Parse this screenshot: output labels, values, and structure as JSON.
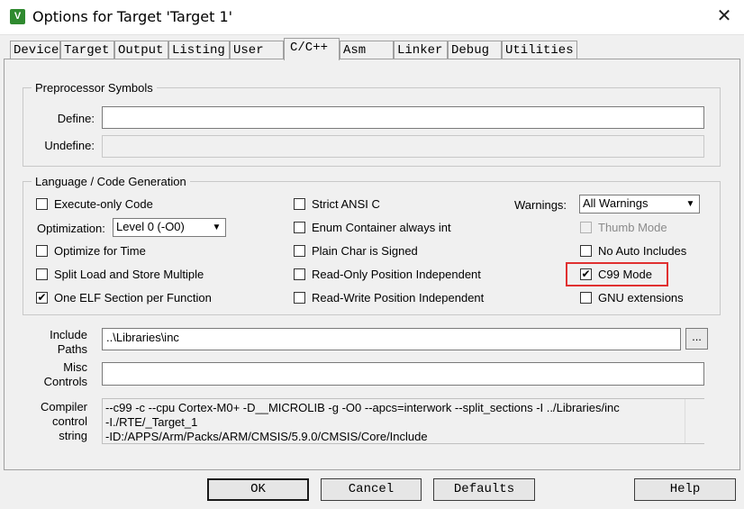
{
  "window": {
    "title": "Options for Target 'Target 1'",
    "close_glyph": "✕",
    "icon_glyph": "V"
  },
  "tabs": [
    "Device",
    "Target",
    "Output",
    "Listing",
    "User",
    "C/C++",
    "Asm",
    "Linker",
    "Debug",
    "Utilities"
  ],
  "active_tab": "C/C++",
  "preprocessor": {
    "title": "Preprocessor Symbols",
    "define_label": "Define:",
    "define_value": "",
    "undefine_label": "Undefine:",
    "undefine_value": ""
  },
  "language": {
    "title": "Language / Code Generation",
    "execute_only": {
      "label": "Execute-only Code",
      "checked": false
    },
    "optimization": {
      "label": "Optimization:",
      "value": "Level 0 (-O0)"
    },
    "optimize_time": {
      "label": "Optimize for Time",
      "checked": false
    },
    "split_load": {
      "label": "Split Load and Store Multiple",
      "checked": false
    },
    "one_elf": {
      "label": "One ELF Section per Function",
      "checked": true
    },
    "strict_ansi": {
      "label": "Strict ANSI C",
      "checked": false
    },
    "enum_container": {
      "label": "Enum Container always int",
      "checked": false
    },
    "plain_char": {
      "label": "Plain Char is Signed",
      "checked": false
    },
    "ro_pi": {
      "label": "Read-Only Position Independent",
      "checked": false
    },
    "rw_pi": {
      "label": "Read-Write Position Independent",
      "checked": false
    },
    "warnings": {
      "label": "Warnings:",
      "value": "All Warnings"
    },
    "thumb_mode": {
      "label": "Thumb Mode",
      "checked": false
    },
    "no_auto_includes": {
      "label": "No Auto Includes",
      "checked": false
    },
    "c99_mode": {
      "label": "C99 Mode",
      "checked": true
    },
    "gnu_ext": {
      "label": "GNU extensions",
      "checked": false
    }
  },
  "include_paths": {
    "label_line1": "Include",
    "label_line2": "Paths",
    "value": "..\\Libraries\\inc",
    "browse": "..."
  },
  "misc_controls": {
    "label_line1": "Misc",
    "label_line2": "Controls",
    "value": ""
  },
  "compiler_string": {
    "label_line1": "Compiler",
    "label_line2": "control",
    "label_line3": "string",
    "lines": [
      "--c99 -c --cpu Cortex-M0+ -D__MICROLIB -g -O0 --apcs=interwork --split_sections -I ../Libraries/inc",
      "-I./RTE/_Target_1",
      "-ID:/APPS/Arm/Packs/ARM/CMSIS/5.9.0/CMSIS/Core/Include"
    ]
  },
  "buttons": {
    "ok": "OK",
    "cancel": "Cancel",
    "defaults": "Defaults",
    "help": "Help"
  },
  "check_glyph": "✔",
  "dropdown_glyph": "▼"
}
